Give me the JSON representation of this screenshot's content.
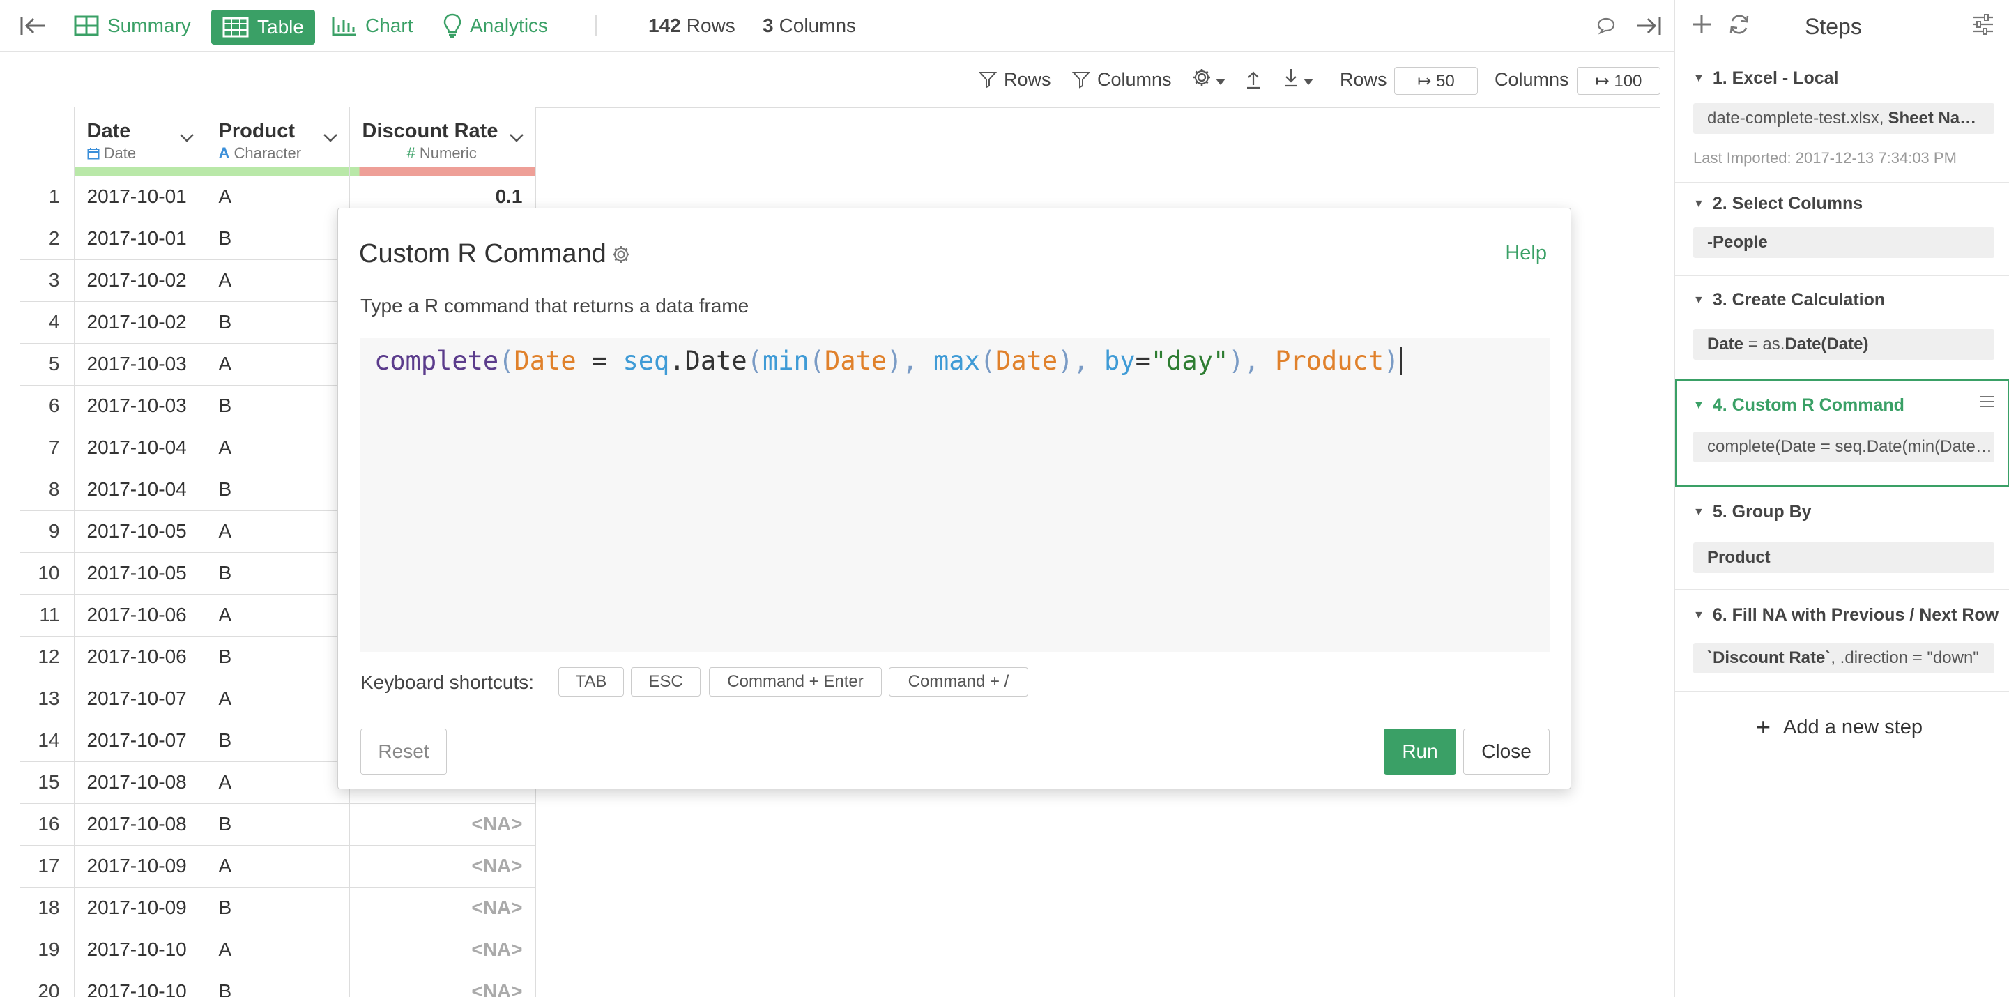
{
  "toolbar": {
    "tabs": [
      {
        "label": "Summary",
        "icon": "summary-icon"
      },
      {
        "label": "Table",
        "icon": "table-icon",
        "active": true
      },
      {
        "label": "Chart",
        "icon": "chart-icon"
      },
      {
        "label": "Analytics",
        "icon": "lightbulb-icon"
      }
    ],
    "rows_count": "142",
    "rows_label": "Rows",
    "cols_count": "3",
    "cols_label": "Columns"
  },
  "toolbar2": {
    "filter_rows": "Rows",
    "filter_cols": "Columns",
    "rows_limit_label": "Rows",
    "rows_limit_value": "↦ 50",
    "cols_limit_label": "Columns",
    "cols_limit_value": "↦ 100"
  },
  "table": {
    "columns": [
      {
        "name": "Date",
        "type": "Date"
      },
      {
        "name": "Product",
        "type": "Character"
      },
      {
        "name": "Discount Rate",
        "type": "Numeric"
      }
    ],
    "rows": [
      {
        "n": "1",
        "date": "2017-10-01",
        "product": "A",
        "rate": "0.1"
      },
      {
        "n": "2",
        "date": "2017-10-01",
        "product": "B",
        "rate": ""
      },
      {
        "n": "3",
        "date": "2017-10-02",
        "product": "A",
        "rate": ""
      },
      {
        "n": "4",
        "date": "2017-10-02",
        "product": "B",
        "rate": ""
      },
      {
        "n": "5",
        "date": "2017-10-03",
        "product": "A",
        "rate": ""
      },
      {
        "n": "6",
        "date": "2017-10-03",
        "product": "B",
        "rate": ""
      },
      {
        "n": "7",
        "date": "2017-10-04",
        "product": "A",
        "rate": ""
      },
      {
        "n": "8",
        "date": "2017-10-04",
        "product": "B",
        "rate": ""
      },
      {
        "n": "9",
        "date": "2017-10-05",
        "product": "A",
        "rate": ""
      },
      {
        "n": "10",
        "date": "2017-10-05",
        "product": "B",
        "rate": ""
      },
      {
        "n": "11",
        "date": "2017-10-06",
        "product": "A",
        "rate": ""
      },
      {
        "n": "12",
        "date": "2017-10-06",
        "product": "B",
        "rate": ""
      },
      {
        "n": "13",
        "date": "2017-10-07",
        "product": "A",
        "rate": ""
      },
      {
        "n": "14",
        "date": "2017-10-07",
        "product": "B",
        "rate": ""
      },
      {
        "n": "15",
        "date": "2017-10-08",
        "product": "A",
        "rate": ""
      },
      {
        "n": "16",
        "date": "2017-10-08",
        "product": "B",
        "rate": "<NA>"
      },
      {
        "n": "17",
        "date": "2017-10-09",
        "product": "A",
        "rate": "<NA>"
      },
      {
        "n": "18",
        "date": "2017-10-09",
        "product": "B",
        "rate": "<NA>"
      },
      {
        "n": "19",
        "date": "2017-10-10",
        "product": "A",
        "rate": "<NA>"
      },
      {
        "n": "20",
        "date": "2017-10-10",
        "product": "B",
        "rate": "<NA>"
      }
    ]
  },
  "modal": {
    "title": "Custom R Command",
    "help": "Help",
    "description": "Type a R command that returns a data frame",
    "code_tokens": [
      {
        "t": "complete",
        "c": "c-fn"
      },
      {
        "t": "(",
        "c": "c-par"
      },
      {
        "t": "Date",
        "c": "c-var"
      },
      {
        "t": " = ",
        "c": "c-op"
      },
      {
        "t": "seq",
        "c": "c-fn2"
      },
      {
        "t": ".Date",
        "c": "c-op"
      },
      {
        "t": "(",
        "c": "c-par"
      },
      {
        "t": "min",
        "c": "c-fn2"
      },
      {
        "t": "(",
        "c": "c-par"
      },
      {
        "t": "Date",
        "c": "c-var"
      },
      {
        "t": "), ",
        "c": "c-par"
      },
      {
        "t": "max",
        "c": "c-fn2"
      },
      {
        "t": "(",
        "c": "c-par"
      },
      {
        "t": "Date",
        "c": "c-var"
      },
      {
        "t": "), ",
        "c": "c-par"
      },
      {
        "t": "by",
        "c": "c-fn2"
      },
      {
        "t": "=",
        "c": "c-op"
      },
      {
        "t": "\"day\"",
        "c": "c-str"
      },
      {
        "t": "), ",
        "c": "c-par"
      },
      {
        "t": "Product",
        "c": "c-var"
      },
      {
        "t": ")",
        "c": "c-par"
      }
    ],
    "shortcuts_label": "Keyboard shortcuts:",
    "shortcuts": [
      "TAB",
      "ESC",
      "Command + Enter",
      "Command + /"
    ],
    "reset": "Reset",
    "run": "Run",
    "close": "Close"
  },
  "steps": {
    "title": "Steps",
    "items": [
      {
        "title": "1. Excel - Local",
        "box": "date-complete-test.xlsx, ",
        "box_bold": "Sheet Na…",
        "meta": "Last Imported: 2017-12-13 7:34:03 PM"
      },
      {
        "title": "2. Select Columns",
        "box_bold": "-People"
      },
      {
        "title": "3. Create Calculation",
        "box_bold": "Date",
        "box": " = as.",
        "box_bold2": "Date(Date)"
      },
      {
        "title": "4. Custom R Command",
        "box": "complete(Date = seq.Date(min(Date…"
      },
      {
        "title": "5. Group By",
        "box_bold": "Product"
      },
      {
        "title": "6. Fill NA with Previous / Next Row",
        "box_bold": "`Discount Rate`",
        "box": ", .direction = \"down\""
      }
    ],
    "add_step": "Add a new step"
  },
  "colors": {
    "accent": "#3aa066",
    "date_quality_bar": "#b9e8a8",
    "numeric_quality_bar": "#ee9f97"
  }
}
